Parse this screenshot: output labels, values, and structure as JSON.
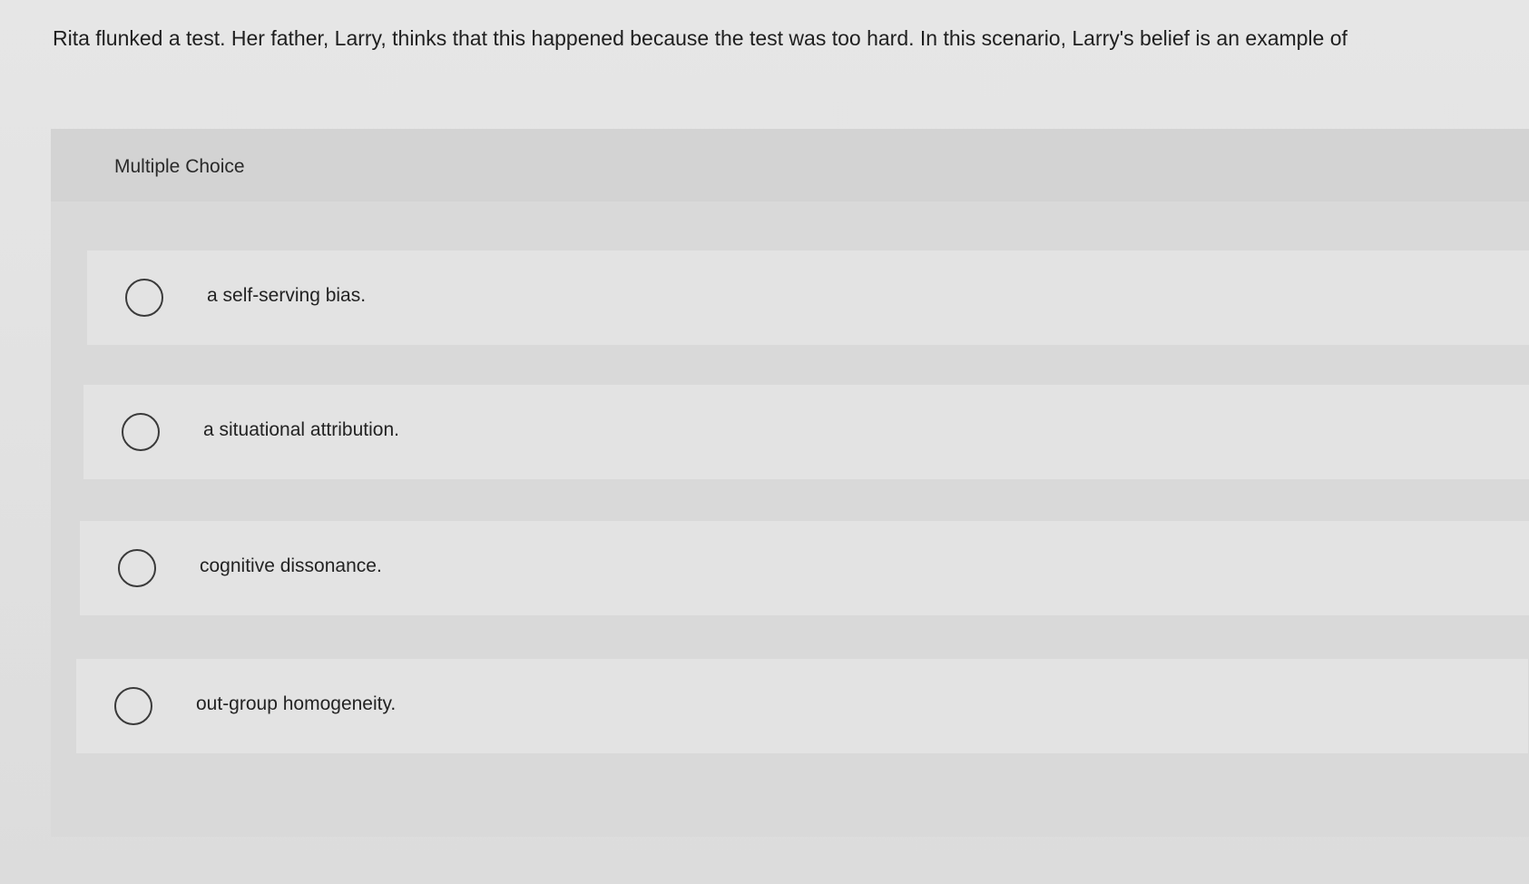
{
  "question": {
    "text": "Rita flunked a test. Her father, Larry, thinks that this happened because the test was too hard. In this scenario, Larry's belief is an example of"
  },
  "panel": {
    "header_label": "Multiple Choice"
  },
  "options": [
    {
      "label": "a self-serving bias.",
      "selected": false
    },
    {
      "label": "a situational attribution.",
      "selected": false
    },
    {
      "label": "cognitive dissonance.",
      "selected": false
    },
    {
      "label": "out-group homogeneity.",
      "selected": false
    }
  ],
  "colors": {
    "background": "#e4e4e4",
    "panel": "#d9d9d9",
    "option_row": "#e3e3e3",
    "text": "#222222"
  }
}
